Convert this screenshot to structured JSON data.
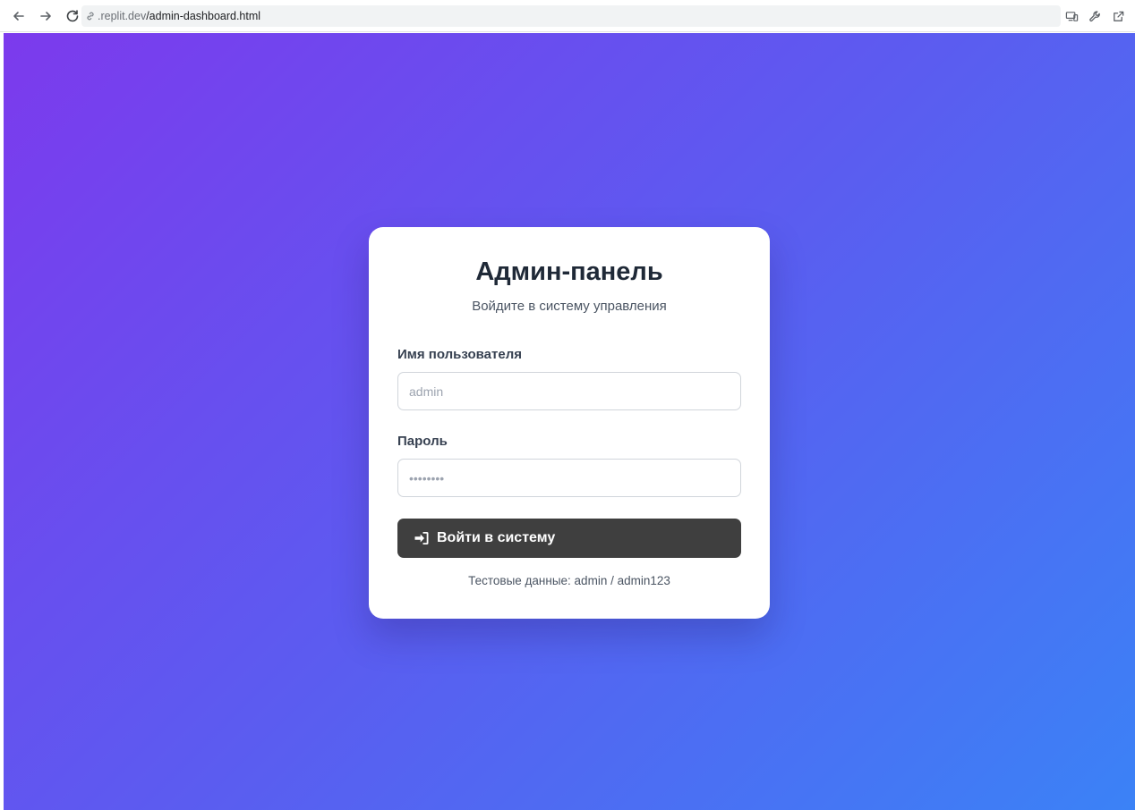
{
  "browser": {
    "url_domain": ".replit.dev",
    "url_path": "/admin-dashboard.html"
  },
  "login": {
    "title": "Админ-панель",
    "subtitle": "Войдите в систему управления",
    "username_label": "Имя пользователя",
    "username_placeholder": "admin",
    "password_label": "Пароль",
    "password_placeholder": "••••••••",
    "submit_label": "Войти в систему",
    "hint": "Тестовые данные: admin / admin123"
  },
  "colors": {
    "gradient_start": "#7c3aed",
    "gradient_end": "#3b82f6",
    "button_bg": "#3f3f3f"
  },
  "icons": {
    "back": "arrow-left-icon",
    "forward": "arrow-right-icon",
    "reload": "reload-icon",
    "link": "link-icon",
    "devices": "devices-icon",
    "wrench": "wrench-icon",
    "external": "external-link-icon",
    "login": "sign-in-icon"
  }
}
